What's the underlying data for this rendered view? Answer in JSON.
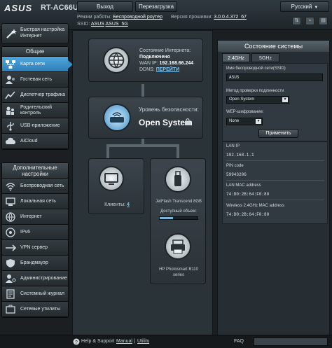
{
  "header": {
    "brand": "ASUS",
    "model": "RT-AC66U",
    "logout": "Выход",
    "reboot": "Перезагрузка",
    "language": "Русский",
    "mode_label": "Режим работы:",
    "mode_value": "Беспроводной роутер",
    "fw_label": "Версия прошивки:",
    "fw_value": "3.0.0.4.372_67",
    "ssid_label": "SSID:",
    "ssid_1": "ASUS",
    "ssid_2": "ASUS_5G"
  },
  "sidebar": {
    "quick": "Быстрая настройка Интернет",
    "general_title": "Общие",
    "general": [
      {
        "label": "Карта сети",
        "icon": "network-map-icon",
        "active": true
      },
      {
        "label": "Гостевая сеть",
        "icon": "guest-network-icon"
      },
      {
        "label": "Диспетчер трафика",
        "icon": "traffic-manager-icon"
      },
      {
        "label": "Родительский контроль",
        "icon": "parental-control-icon"
      },
      {
        "label": "USB-приложение",
        "icon": "usb-app-icon"
      },
      {
        "label": "AiCloud",
        "icon": "aicloud-icon"
      }
    ],
    "advanced_title": "Дополнительные настройки",
    "advanced": [
      {
        "label": "Беспроводная сеть",
        "icon": "wireless-icon"
      },
      {
        "label": "Локальная сеть",
        "icon": "lan-icon"
      },
      {
        "label": "Интернет",
        "icon": "wan-icon"
      },
      {
        "label": "IPv6",
        "icon": "ipv6-icon"
      },
      {
        "label": "VPN сервер",
        "icon": "vpn-icon"
      },
      {
        "label": "Брандмауэр",
        "icon": "firewall-icon"
      },
      {
        "label": "Администрирование",
        "icon": "admin-icon"
      },
      {
        "label": "Системный журнал",
        "icon": "syslog-icon"
      },
      {
        "label": "Сетевые утилиты",
        "icon": "tools-icon"
      }
    ]
  },
  "map": {
    "inet_status_label": "Состояние Интернета:",
    "inet_status": "Подключено",
    "wan_ip_label": "WAN IP:",
    "wan_ip": "192.168.66.244",
    "ddns_label": "DDNS:",
    "ddns_link": "ПЕРЕЙТИ",
    "security_label": "Уровень безопасности:",
    "security_value": "Open System",
    "clients_label": "Клиенты:",
    "clients_count": "4",
    "usb_device": "JetFlash Transcend 8GB",
    "usb_space_label": "Доступный объем:",
    "usb_space_fraction": 0.35,
    "printer": "HP Photosmart B110 series"
  },
  "panel": {
    "title": "Состояние системы",
    "tab_24": "2.4GHz",
    "tab_5": "5GHz",
    "ssid_label": "Имя беспроводной сети(SSID)",
    "ssid_value": "ASUS",
    "auth_label": "Метод проверки подлинности",
    "auth_value": "Open System",
    "wep_label": "WEP-шифрование:",
    "wep_value": "None",
    "apply": "Применить",
    "lan_ip_label": "LAN IP",
    "lan_ip": "192.168.1.1",
    "pin_label": "PIN code",
    "pin": "59943206",
    "lan_mac_label": "LAN MAC address",
    "lan_mac": "74:D0:2B:64:F0:80",
    "wmac_label": "Wireless 2.4GHz MAC address",
    "wmac": "74:D0:2B:64:F0:80"
  },
  "footer": {
    "help": "Help & Support",
    "manual": "Manual",
    "utility": "Utility",
    "faq": "FAQ"
  },
  "colors": {
    "accent": "#3790c9",
    "link": "#7fc4f1"
  }
}
